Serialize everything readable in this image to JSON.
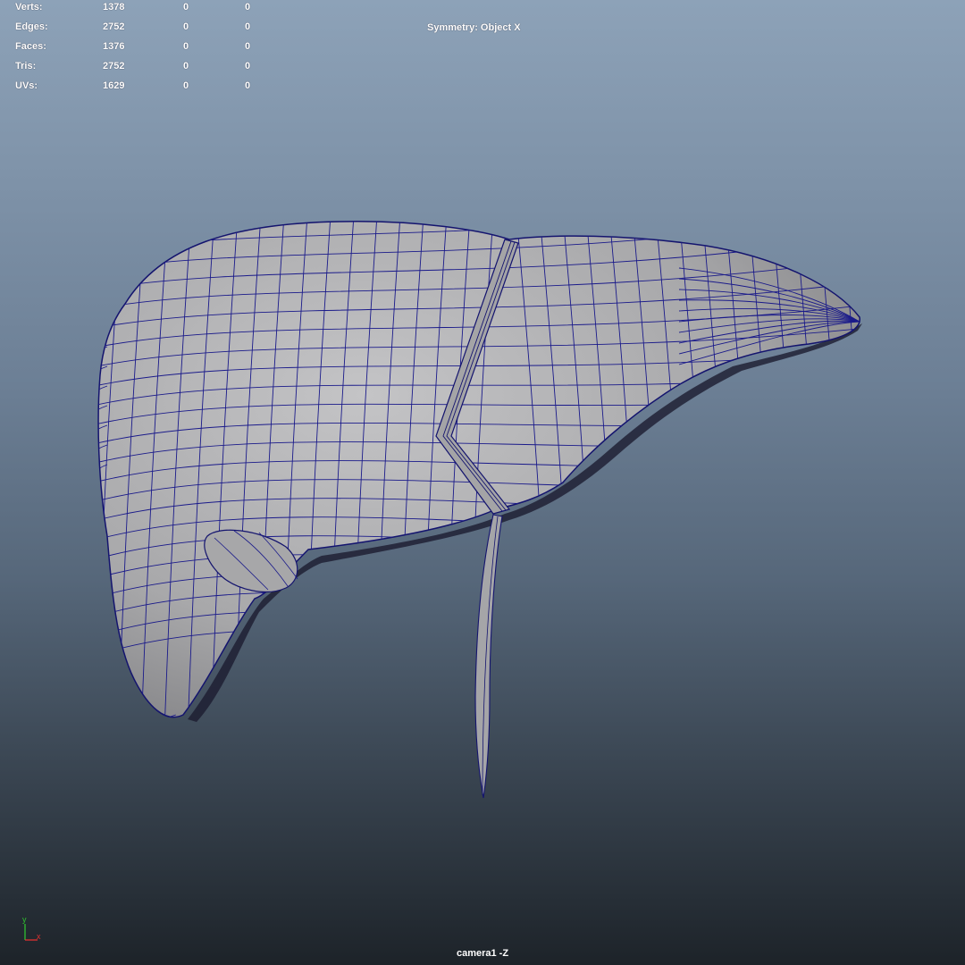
{
  "hud": {
    "rows": [
      {
        "label": "Verts:",
        "c1": "1378",
        "c2": "0",
        "c3": "0"
      },
      {
        "label": "Edges:",
        "c1": "2752",
        "c2": "0",
        "c3": "0"
      },
      {
        "label": "Faces:",
        "c1": "1376",
        "c2": "0",
        "c3": "0"
      },
      {
        "label": "Tris:",
        "c1": "2752",
        "c2": "0",
        "c3": "0"
      },
      {
        "label": "UVs:",
        "c1": "1629",
        "c2": "0",
        "c3": "0"
      }
    ],
    "symmetry": "Symmetry: Object X"
  },
  "viewport": {
    "camera": "camera1 -Z",
    "axis": {
      "y": "y",
      "x": "x"
    },
    "colors": {
      "mesh_fill": "#a9a9ab",
      "wire": "#1a1a7a",
      "axis_x": "#e03030",
      "axis_y": "#30c030"
    }
  }
}
